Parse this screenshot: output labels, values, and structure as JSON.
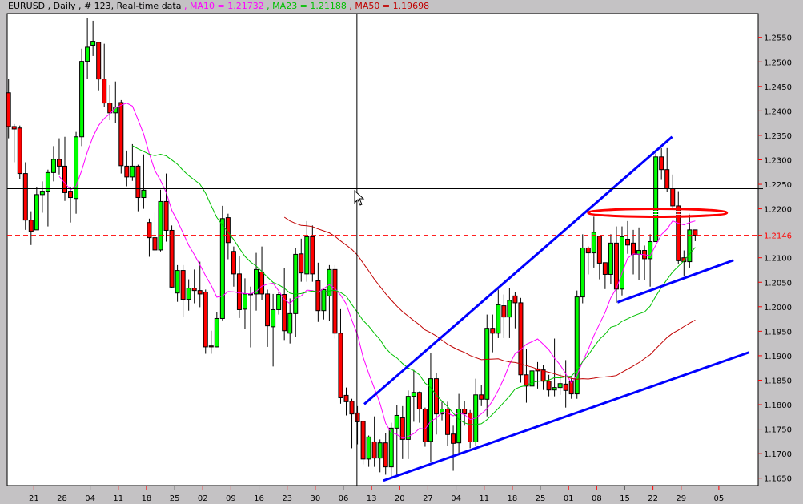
{
  "header": {
    "symbol_info": "EURUSD , Daily , # 123, Real-time data",
    "ma10": " , MA10 = 1.21732",
    "ma23": " , MA23 = 1.21188",
    "ma50": " , MA50 = 1.19698"
  },
  "colors": {
    "background": "#c4c2c4",
    "plot": "#ffffff",
    "bull": "#00ff00",
    "bear": "#ff0000",
    "ma10": "#ff00ff",
    "ma23": "#00c000",
    "ma50": "#c00000",
    "trendline": "#0000ff",
    "bid_line": "#ff0000"
  },
  "chart_data": {
    "type": "candlestick",
    "title": "EURUSD , Daily , # 123, Real-time data",
    "ylim": [
      1.1625,
      1.26
    ],
    "y_ticks": [
      "1.2550",
      "1.2500",
      "1.2450",
      "1.2400",
      "1.2350",
      "1.2300",
      "1.2250",
      "1.2200",
      "1.2100",
      "1.2050",
      "1.2000",
      "1.1950",
      "1.1900",
      "1.1850",
      "1.1800",
      "1.1750",
      "1.1700",
      "1.1650"
    ],
    "bid_label": "1.2146",
    "bid_price": 1.2146,
    "crosshair": {
      "bar": 61.9,
      "price": 1.2241
    },
    "x_ticks": [
      {
        "label": "21",
        "bar": 4.5
      },
      {
        "label": "28",
        "bar": 9.5
      },
      {
        "label": "04",
        "bar": 14.5,
        "minor": true
      },
      {
        "label": "11",
        "bar": 19.5
      },
      {
        "label": "18",
        "bar": 24.5
      },
      {
        "label": "25",
        "bar": 29.5,
        "minor": true
      },
      {
        "label": "02",
        "bar": 34.5
      },
      {
        "label": "09",
        "bar": 39.5
      },
      {
        "label": "16",
        "bar": 44.5,
        "minor": true
      },
      {
        "label": "23",
        "bar": 49.5
      },
      {
        "label": "30",
        "bar": 54.5
      },
      {
        "label": "06",
        "bar": 59.5,
        "minor": true
      },
      {
        "label": "13",
        "bar": 64.5
      },
      {
        "label": "20",
        "bar": 69.5
      },
      {
        "label": "27",
        "bar": 74.5
      },
      {
        "label": "04",
        "bar": 79.5,
        "minor": true
      },
      {
        "label": "11",
        "bar": 84.5
      },
      {
        "label": "18",
        "bar": 89.5
      },
      {
        "label": "25",
        "bar": 94.5,
        "minor": true
      },
      {
        "label": "01",
        "bar": 99.5
      },
      {
        "label": "08",
        "bar": 104.5
      },
      {
        "label": "15",
        "bar": 109.5,
        "minor": true
      },
      {
        "label": "22",
        "bar": 114.5
      },
      {
        "label": "29",
        "bar": 119.5
      },
      {
        "label": "05",
        "bar": 126.2
      }
    ],
    "ma_periods": [
      10,
      23,
      50
    ],
    "ohlc_columns": [
      "open",
      "high",
      "low",
      "close"
    ],
    "ohlc": [
      [
        1.2437,
        1.2465,
        1.2344,
        1.2368
      ],
      [
        1.2368,
        1.2373,
        1.2295,
        1.2363
      ],
      [
        1.2365,
        1.237,
        1.226,
        1.2272
      ],
      [
        1.2272,
        1.2295,
        1.2157,
        1.2177
      ],
      [
        1.2177,
        1.2195,
        1.2126,
        1.2154
      ],
      [
        1.2157,
        1.2244,
        1.2157,
        1.2229
      ],
      [
        1.2229,
        1.2256,
        1.2192,
        1.2236
      ],
      [
        1.2236,
        1.228,
        1.2164,
        1.2274
      ],
      [
        1.2274,
        1.2328,
        1.2256,
        1.2301
      ],
      [
        1.2301,
        1.2344,
        1.227,
        1.2287
      ],
      [
        1.2287,
        1.2347,
        1.2216,
        1.2233
      ],
      [
        1.2236,
        1.2244,
        1.2172,
        1.2223
      ],
      [
        1.2221,
        1.2357,
        1.219,
        1.2347
      ],
      [
        1.2347,
        1.2527,
        1.2328,
        1.2501
      ],
      [
        1.2501,
        1.2589,
        1.2465,
        1.253
      ],
      [
        1.2534,
        1.2584,
        1.2512,
        1.2542
      ],
      [
        1.254,
        1.254,
        1.2442,
        1.2465
      ],
      [
        1.2465,
        1.2537,
        1.2408,
        1.2416
      ],
      [
        1.2416,
        1.2453,
        1.2381,
        1.2396
      ],
      [
        1.2396,
        1.246,
        1.2375,
        1.2408
      ],
      [
        1.2417,
        1.2422,
        1.2272,
        1.2288
      ],
      [
        1.2287,
        1.2319,
        1.2246,
        1.2265
      ],
      [
        1.2265,
        1.2332,
        1.2257,
        1.2287
      ],
      [
        1.2287,
        1.229,
        1.2195,
        1.2223
      ],
      [
        1.2223,
        1.2311,
        1.22,
        1.2238
      ],
      [
        1.2172,
        1.218,
        1.2102,
        1.2141
      ],
      [
        1.2141,
        1.2192,
        1.2113,
        1.2116
      ],
      [
        1.2116,
        1.2239,
        1.2113,
        1.2215
      ],
      [
        1.2215,
        1.2272,
        1.2133,
        1.2156
      ],
      [
        1.2156,
        1.2166,
        1.2038,
        1.204
      ],
      [
        1.2028,
        1.2085,
        1.201,
        1.2074
      ],
      [
        1.2074,
        1.2085,
        1.1979,
        1.2015
      ],
      [
        1.2015,
        1.2056,
        1.1992,
        1.2038
      ],
      [
        1.2038,
        1.2076,
        1.2007,
        1.2033
      ],
      [
        1.2033,
        1.2092,
        1.1999,
        1.2026
      ],
      [
        1.203,
        1.2035,
        1.1904,
        1.1918
      ],
      [
        1.192,
        1.1951,
        1.1904,
        1.1918
      ],
      [
        1.1918,
        1.1989,
        1.1917,
        1.1976
      ],
      [
        1.1976,
        1.2206,
        1.1972,
        1.218
      ],
      [
        1.2182,
        1.219,
        1.2097,
        1.2131
      ],
      [
        1.2113,
        1.2123,
        1.2041,
        1.2067
      ],
      [
        1.2067,
        1.2103,
        1.1977,
        1.1994
      ],
      [
        1.1995,
        1.2058,
        1.1954,
        1.2026
      ],
      [
        1.2026,
        1.2041,
        1.1917,
        1.2025
      ],
      [
        1.2026,
        1.211,
        1.1992,
        1.2076
      ],
      [
        1.2071,
        1.2123,
        1.2013,
        1.2026
      ],
      [
        1.2026,
        1.2035,
        1.1918,
        1.1961
      ],
      [
        1.1959,
        1.2026,
        1.1878,
        1.1994
      ],
      [
        1.1994,
        1.2031,
        1.1984,
        1.2025
      ],
      [
        1.2025,
        1.2079,
        1.1932,
        1.1951
      ],
      [
        1.1946,
        1.2017,
        1.1925,
        1.1986
      ],
      [
        1.1986,
        1.212,
        1.1938,
        1.2107
      ],
      [
        1.2108,
        1.2139,
        1.2051,
        1.2069
      ],
      [
        1.2067,
        1.2175,
        1.2051,
        1.2143
      ],
      [
        1.2143,
        1.2166,
        1.2051,
        1.2067
      ],
      [
        1.2053,
        1.209,
        1.1969,
        1.1992
      ],
      [
        1.1992,
        1.2035,
        1.1974,
        1.2035
      ],
      [
        1.2022,
        1.2085,
        1.1971,
        1.2076
      ],
      [
        1.2076,
        1.2085,
        1.1935,
        1.1946
      ],
      [
        1.1946,
        1.1995,
        1.1802,
        1.1814
      ],
      [
        1.1819,
        1.1835,
        1.1778,
        1.1806
      ],
      [
        1.1807,
        1.1812,
        1.1711,
        1.1781
      ],
      [
        1.1783,
        1.1797,
        1.1719,
        1.1765
      ],
      [
        1.1766,
        1.1766,
        1.1678,
        1.1689
      ],
      [
        1.1689,
        1.1737,
        1.1673,
        1.1734
      ],
      [
        1.1724,
        1.1776,
        1.1673,
        1.1691
      ],
      [
        1.1691,
        1.1729,
        1.1662,
        1.1722
      ],
      [
        1.1722,
        1.1742,
        1.1657,
        1.1673
      ],
      [
        1.1673,
        1.1763,
        1.1653,
        1.1752
      ],
      [
        1.1752,
        1.1799,
        1.1657,
        1.1778
      ],
      [
        1.1773,
        1.1797,
        1.1689,
        1.1729
      ],
      [
        1.1729,
        1.1829,
        1.1689,
        1.1817
      ],
      [
        1.1817,
        1.1871,
        1.1765,
        1.1825
      ],
      [
        1.1825,
        1.1827,
        1.1763,
        1.1791
      ],
      [
        1.1791,
        1.1794,
        1.1714,
        1.1724
      ],
      [
        1.1725,
        1.1905,
        1.1683,
        1.1853
      ],
      [
        1.1853,
        1.1865,
        1.1739,
        1.1781
      ],
      [
        1.1781,
        1.1806,
        1.1768,
        1.1791
      ],
      [
        1.1791,
        1.1806,
        1.1716,
        1.1739
      ],
      [
        1.174,
        1.1757,
        1.1665,
        1.1721
      ],
      [
        1.1722,
        1.1822,
        1.1699,
        1.1791
      ],
      [
        1.1791,
        1.1807,
        1.1757,
        1.1781
      ],
      [
        1.1783,
        1.1789,
        1.1711,
        1.1724
      ],
      [
        1.1724,
        1.1853,
        1.1716,
        1.182
      ],
      [
        1.182,
        1.184,
        1.1797,
        1.1811
      ],
      [
        1.1811,
        1.1984,
        1.1776,
        1.1956
      ],
      [
        1.1956,
        1.1984,
        1.1907,
        1.1946
      ],
      [
        1.1946,
        1.2035,
        1.1936,
        1.2004
      ],
      [
        1.2002,
        1.2025,
        1.1936,
        1.1979
      ],
      [
        1.1979,
        1.2038,
        1.1936,
        1.2013
      ],
      [
        1.2022,
        1.203,
        1.1956,
        1.2008
      ],
      [
        1.2008,
        1.2018,
        1.1845,
        1.1861
      ],
      [
        1.1861,
        1.1914,
        1.1804,
        1.1838
      ],
      [
        1.1838,
        1.19,
        1.1814,
        1.1869
      ],
      [
        1.1873,
        1.1887,
        1.1833,
        1.1869
      ],
      [
        1.1871,
        1.1881,
        1.183,
        1.1848
      ],
      [
        1.1848,
        1.1861,
        1.1817,
        1.183
      ],
      [
        1.183,
        1.1935,
        1.1817,
        1.1835
      ],
      [
        1.1835,
        1.1863,
        1.182,
        1.1843
      ],
      [
        1.1842,
        1.1891,
        1.1794,
        1.1829
      ],
      [
        1.1847,
        1.1855,
        1.1812,
        1.1822
      ],
      [
        1.1822,
        1.2033,
        1.1812,
        1.202
      ],
      [
        1.202,
        1.2148,
        1.2007,
        1.212
      ],
      [
        1.212,
        1.2123,
        1.2066,
        1.211
      ],
      [
        1.211,
        1.2184,
        1.208,
        1.2152
      ],
      [
        1.2144,
        1.2144,
        1.2056,
        1.2089
      ],
      [
        1.209,
        1.209,
        1.2036,
        1.2066
      ],
      [
        1.2066,
        1.2148,
        1.2046,
        1.213
      ],
      [
        1.213,
        1.2164,
        1.2008,
        1.2036
      ],
      [
        1.2036,
        1.2164,
        1.2023,
        1.2143
      ],
      [
        1.2138,
        1.2175,
        1.2108,
        1.2126
      ],
      [
        1.213,
        1.2157,
        1.2066,
        1.2107
      ],
      [
        1.2107,
        1.2162,
        1.2054,
        1.2115
      ],
      [
        1.2115,
        1.2125,
        1.2054,
        1.2098
      ],
      [
        1.2098,
        1.2148,
        1.2041,
        1.2133
      ],
      [
        1.2133,
        1.2313,
        1.2133,
        1.2306
      ],
      [
        1.2306,
        1.2324,
        1.2259,
        1.228
      ],
      [
        1.228,
        1.2324,
        1.2234,
        1.2241
      ],
      [
        1.2241,
        1.227,
        1.22,
        1.2206
      ],
      [
        1.2206,
        1.2236,
        1.2087,
        1.2094
      ],
      [
        1.21,
        1.2115,
        1.2062,
        1.2092
      ],
      [
        1.2092,
        1.219,
        1.208,
        1.2157
      ],
      [
        1.2157,
        1.2157,
        1.2134,
        1.2146
      ]
    ],
    "trendlines": [
      {
        "from": {
          "bar": 63.2,
          "price": 1.1801
        },
        "to": {
          "bar": 117.9,
          "price": 1.2347
        }
      },
      {
        "from": {
          "bar": 66.6,
          "price": 1.1645
        },
        "to": {
          "bar": 131.6,
          "price": 1.1907
        }
      },
      {
        "from": {
          "bar": 108.2,
          "price": 1.2009
        },
        "to": {
          "bar": 128.8,
          "price": 1.2095
        }
      }
    ],
    "ellipse": {
      "from_bar": 103.0,
      "to_bar": 127.6,
      "price": 1.2192
    }
  }
}
